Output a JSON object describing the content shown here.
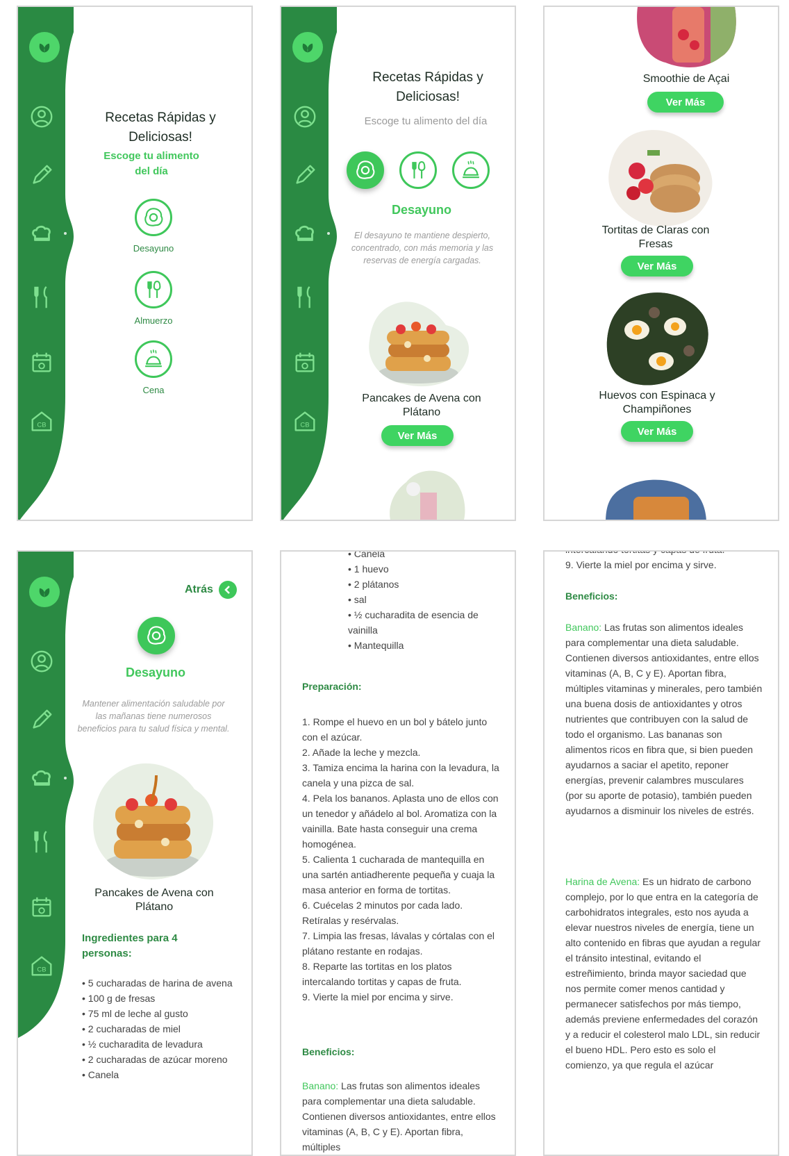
{
  "colors": {
    "rail": "#2a8a43",
    "accent": "#41c75c",
    "button": "#3fd462",
    "logo": "#4ed66a"
  },
  "nav_icons": [
    "leaf-logo-icon",
    "user-icon",
    "pencil-icon",
    "chef-hat-icon",
    "fork-knife-icon",
    "calendar-icon",
    "home-cb-icon"
  ],
  "screen1": {
    "title": "Recetas Rápidas y Deliciosas!",
    "subtitle": "Escoge tu alimento del día",
    "categories": [
      {
        "label": "Desayuno",
        "icon": "egg-icon"
      },
      {
        "label": "Almuerzo",
        "icon": "cutlery-icon"
      },
      {
        "label": "Cena",
        "icon": "cloche-icon"
      }
    ]
  },
  "screen2": {
    "title": "Recetas Rápidas y Deliciosas!",
    "subtitle": "Escoge tu alimento del día",
    "section": "Desayuno",
    "description": "El desayuno te mantiene despierto, concentrado, con más memoria y las reservas de energía cargadas.",
    "recipe": "Pancakes de Avena con Plátano",
    "button": "Ver Más"
  },
  "screen3": {
    "recipes": [
      {
        "name": "Smoothie de Açai",
        "button": "Ver Más"
      },
      {
        "name": "Tortitas de Claras con Fresas",
        "button": "Ver Más"
      },
      {
        "name": "Huevos con Espinaca y Champiñones",
        "button": "Ver Más"
      }
    ]
  },
  "screen4": {
    "back": "Atrás",
    "section": "Desayuno",
    "description": "Mantener alimentación saludable por las mañanas tiene numerosos beneficios para tu salud física y mental.",
    "recipe": "Pancakes de Avena con Plátano",
    "ingredients_title": "Ingredientes para 4 personas:",
    "ingredients": [
      "• 5 cucharadas de harina de avena",
      "• 100 g de fresas",
      "• 75 ml de leche al gusto",
      "• 2 cucharadas de miel",
      "• ½ cucharadita de levadura",
      "• 2 cucharadas de azúcar moreno",
      "• Canela"
    ]
  },
  "screen5": {
    "ingredients": [
      "• Canela",
      "• 1 huevo",
      "• 2 plátanos",
      "• sal",
      "• ½ cucharadita de esencia de vainilla",
      "• Mantequilla"
    ],
    "prep_title": "Preparación:",
    "steps": [
      "1. Rompe el huevo en un bol y bátelo junto con el azúcar.",
      "2. Añade la leche y mezcla.",
      "3. Tamiza encima la harina con la levadura, la canela y una pizca de sal.",
      "4. Pela los bananos. Aplasta uno de ellos con un tenedor y añádelo al bol. Aromatiza con la vainilla. Bate hasta conseguir una crema homogénea.",
      "5. Calienta 1 cucharada de mantequilla en una sartén antiadherente pequeña y cuaja la masa anterior en forma de tortitas.",
      "6. Cuécelas 2 minutos por cada lado. Retíralas y resérvalas.",
      "7. Limpia las fresas, lávalas y córtalas con el plátano restante en rodajas.",
      "8. Reparte las tortitas en los platos intercalando tortitas y capas de fruta.",
      "9. Vierte la miel por encima y sirve."
    ],
    "benefits_title": "Beneficios:",
    "benefit_kw": "Banano:",
    "benefit_text": " Las frutas son alimentos ideales para complementar una dieta saludable. Contienen diversos antioxidantes, entre ellos vitaminas (A, B, C y E). Aportan fibra, múltiples"
  },
  "screen6": {
    "top_cut": "intercalando tortitas y capas de fruta.",
    "step9": "9. Vierte la miel por encima y sirve.",
    "benefits_title": "Beneficios:",
    "banano_kw": "Banano:",
    "banano_text": " Las frutas son alimentos ideales para complementar una dieta saludable. Contienen diversos antioxidantes, entre ellos vitaminas (A, B, C y E). Aportan fibra, múltiples vitaminas y minerales, pero también una buena dosis de antioxidantes y otros nutrientes que contribuyen con la salud de todo el organismo. Las bananas son alimentos ricos en fibra que, si bien pueden ayudarnos a saciar el apetito, reponer energías, prevenir calambres musculares (por su aporte de potasio), también pueden ayudarnos a disminuir los niveles de estrés.",
    "avena_kw": "Harina de Avena:",
    "avena_text": " Es un hidrato de carbono complejo, por lo que entra en la categoría de carbohidratos integrales, esto nos ayuda a elevar nuestros niveles de energía, tiene un alto contenido en fibras que ayudan a regular el tránsito intestinal, evitando el estreñimiento, brinda mayor saciedad que nos permite comer menos cantidad y permanecer satisfechos por más tiempo, además previene enfermedades del corazón y a reducir el colesterol malo LDL, sin reducir el bueno HDL. Pero esto es solo el comienzo, ya que regula el azúcar"
  }
}
